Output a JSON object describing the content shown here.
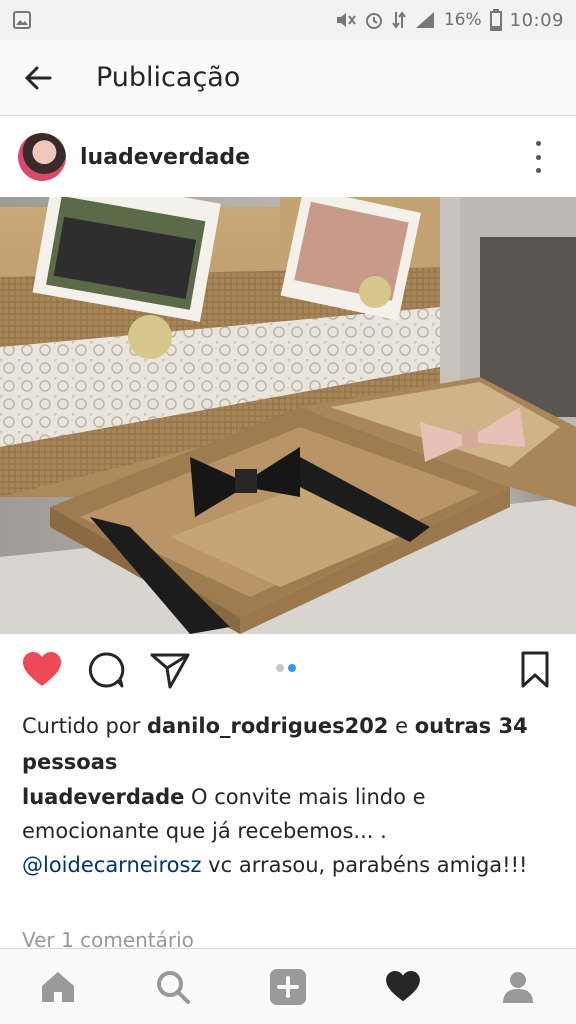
{
  "status_bar": {
    "battery_percent": "16%",
    "time": "10:09",
    "icons": [
      "image-icon",
      "mute-icon",
      "alarm-icon",
      "data-icon",
      "signal-icon",
      "battery-icon"
    ]
  },
  "app_bar": {
    "title": "Publicação"
  },
  "post": {
    "username": "luadeverdade",
    "image_description_icon": "photo",
    "carousel": {
      "total": 2,
      "active": 2
    },
    "likes": {
      "prefix": "Curtido por ",
      "user": "danilo_rodrigues202",
      "middle": " e ",
      "others": "outras 34 pessoas"
    },
    "caption": {
      "author": "luadeverdade",
      "text": " O convite mais lindo e emocionante que já recebemos... . ",
      "mention": "@loidecarneirosz",
      "text_after": " vc arrasou, parabéns amiga!!!"
    },
    "comments_link": "Ver 1 comentário"
  },
  "colors": {
    "like_red": "#ed4956",
    "carousel_active": "#3897f0",
    "carousel_inactive": "#c7c7c7",
    "mention": "#003569"
  },
  "bottom_nav": [
    "home-icon",
    "search-icon",
    "add-icon",
    "heart-icon",
    "profile-icon"
  ]
}
